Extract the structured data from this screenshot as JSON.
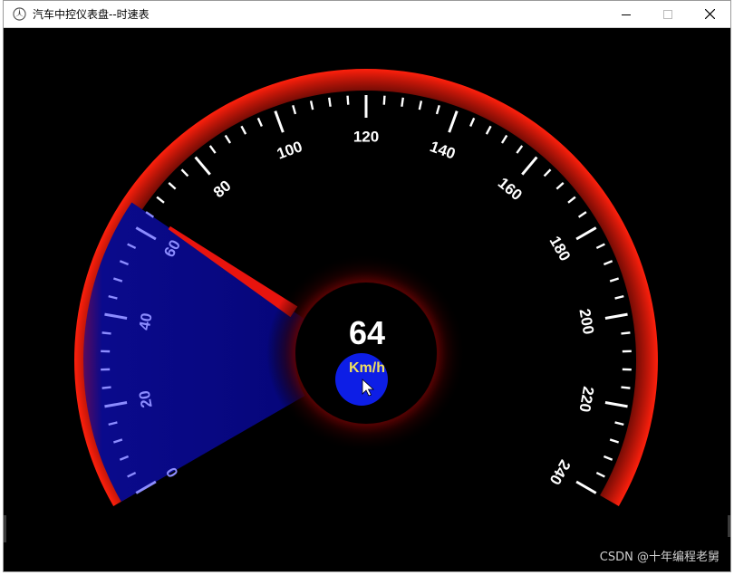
{
  "window": {
    "title": "汽车中控仪表盘--时速表",
    "icon": "mercedes-star-icon",
    "controls": [
      "minimize-icon",
      "maximize-icon",
      "close-icon"
    ]
  },
  "gauge": {
    "speed": "64",
    "unit": "Km/h",
    "speed_value": 64,
    "range": [
      0,
      240
    ],
    "tick_labels": [
      "0",
      "20",
      "40",
      "60",
      "80",
      "100",
      "120",
      "140",
      "160",
      "180",
      "200",
      "220",
      "240"
    ],
    "colors": {
      "background": "#000000",
      "rim": "#ff1a0a",
      "sector": "#08088a",
      "needle": "#e8140e",
      "unit_circle": "#0d1ee6",
      "unit_text": "#f0e060",
      "ticks": "#ffffff"
    }
  },
  "watermark": "CSDN @十年编程老舅"
}
